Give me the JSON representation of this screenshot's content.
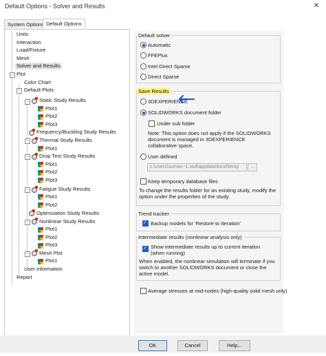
{
  "window": {
    "title": "Default Options - Solver and Results"
  },
  "tabs": [
    "System Options",
    "Default Options"
  ],
  "tree": {
    "items": [
      "Units",
      "Interaction",
      "Load/Fixture",
      "Mesh",
      "Solver and Results",
      "Plot",
      "Color Chart",
      "Default Plots",
      "Static Study Results",
      "Plot1",
      "Plot2",
      "Plot3",
      "Frequency/Buckling Study Results",
      "Thermal Study Results",
      "Plot1",
      "Drop Test Study Results",
      "Plot1",
      "Plot2",
      "Plot3",
      "Fatigue Study Results",
      "Plot1",
      "Plot2",
      "Optimization Study Results",
      "Nonlinear Study Results",
      "Plot1",
      "Plot2",
      "Plot3",
      "Mesh Plot",
      "Plot1",
      "User information",
      "Report"
    ],
    "selected": "Solver and Results"
  },
  "solver": {
    "title": "Default solver",
    "options": [
      "Automatic",
      "FFEPlus",
      "Intel Direct Sparse",
      "Direct Sparse"
    ],
    "selected": 0
  },
  "save_results": {
    "title": "Save Results",
    "opt_3dx": "3DEXPERIENCE",
    "opt_doc": "SOLIDWORKS document folder",
    "sub_folder": "Under sub folder",
    "note": "Note: This option does not apply if the SOLIDWORKS document is managed in 3DEXPERIENCE collaborative space.",
    "opt_user": "User defined",
    "path": "c:\\users\\suman~1.ssd\\appdata\\local\\temp",
    "browse": "...",
    "keep_temp": "Keep temporary database files",
    "info": "To change the results folder for an existing study, modify the option under the properties of the study."
  },
  "trend": {
    "title": "Trend tracker",
    "backup": "Backup models for 'Restore to Iteration'"
  },
  "intermediate": {
    "title": "Intermediate results (nonlinear analysis only)",
    "show": "Show intermediate results up to current iteration (when running)",
    "note": "When enabled, the nonlinear simulation will terminate if you switch to another SOLIDWORKS document or close the active model."
  },
  "average": "Average stresses at mid-nodes (high-quality solid mesh only)",
  "buttons": {
    "ok": "OK",
    "cancel": "Cancel",
    "help": "Help..."
  },
  "colors": {
    "highlight": "#fff27a",
    "arrow": "#1e4fd8",
    "accent": "#1f5fbf"
  }
}
